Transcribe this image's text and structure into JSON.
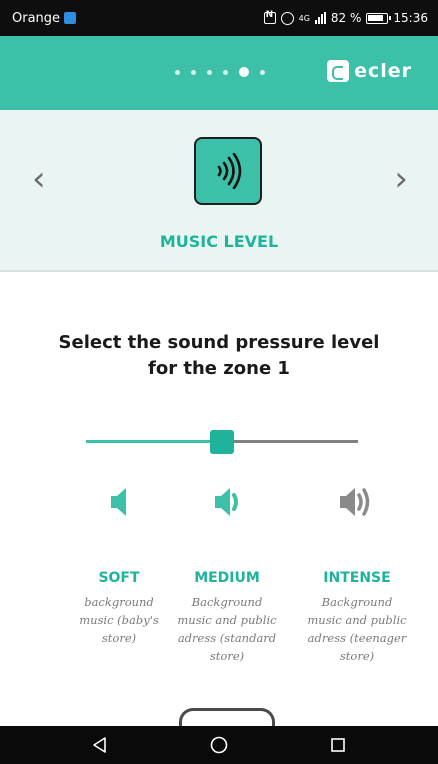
{
  "status_bar": {
    "carrier": "Orange",
    "signal_label": "4G",
    "battery": "82 %",
    "time": "15:36"
  },
  "top_bar": {
    "brand": "ecler",
    "pager": {
      "total": 6,
      "active_index": 4
    }
  },
  "hero": {
    "title": "MUSIC LEVEL",
    "icon": "speaker-waves-icon"
  },
  "question": {
    "line1": "Select the sound pressure level",
    "line2": "for the zone 1"
  },
  "slider": {
    "value": 0.5
  },
  "levels": [
    {
      "label": "SOFT",
      "desc": [
        "background",
        "music (baby's",
        "store)"
      ],
      "icon": "speaker-soft-icon"
    },
    {
      "label": "MEDIUM",
      "desc": [
        "Background",
        "music and public",
        "adress (standard",
        "store)"
      ],
      "icon": "speaker-medium-icon"
    },
    {
      "label": "INTENSE",
      "desc": [
        "Background",
        "music and public",
        "adress (teenager",
        "store)"
      ],
      "icon": "speaker-intense-icon"
    }
  ],
  "colors": {
    "accent": "#3cc0a8",
    "accent_dark": "#1eb39a",
    "hero_bg": "#eaf5f3",
    "inactive_icon": "#8a8a8a"
  },
  "nav_bar": {
    "icons": [
      "back-icon",
      "home-icon",
      "recents-icon"
    ]
  }
}
